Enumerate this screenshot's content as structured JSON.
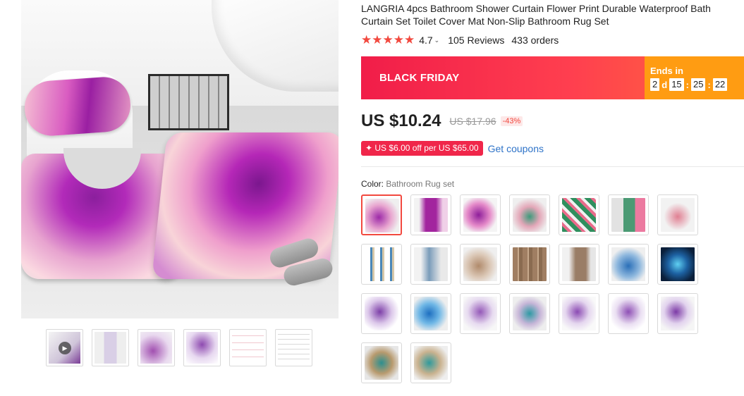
{
  "product": {
    "title": "LANGRIA 4pcs Bathroom Shower Curtain Flower Print Durable Waterproof Bath Curtain Set Toilet Cover Mat Non-Slip Bathroom Rug Set",
    "stars": "★★★★★",
    "rating": "4.7",
    "reviews": "105 Reviews",
    "orders": "433 orders"
  },
  "promo": {
    "label": "BLACK FRIDAY",
    "ends_in": "Ends in",
    "days": "2",
    "days_unit": "d",
    "hours": "15",
    "minutes": "25",
    "seconds": "22",
    "bg_color": "#f11d49",
    "timer_bg_color": "#ff9c12"
  },
  "price": {
    "current": "US $10.24",
    "original": "US $17.96",
    "discount": "-43%"
  },
  "coupon": {
    "label": "✦ US $6.00 off per US $65.00",
    "link": "Get coupons"
  },
  "color": {
    "label": "Color:",
    "value": "Bathroom Rug set"
  },
  "thumbnails": [
    {
      "icon": "video-thumbnail"
    },
    {
      "icon": "shower-curtain-thumbnail"
    },
    {
      "icon": "bath-mats-thumbnail"
    },
    {
      "icon": "purple-tulips-thumbnail"
    },
    {
      "icon": "dimensions-diagram-thumbnail"
    },
    {
      "icon": "size-chart-thumbnail"
    }
  ],
  "accent_color": "#f2493f"
}
